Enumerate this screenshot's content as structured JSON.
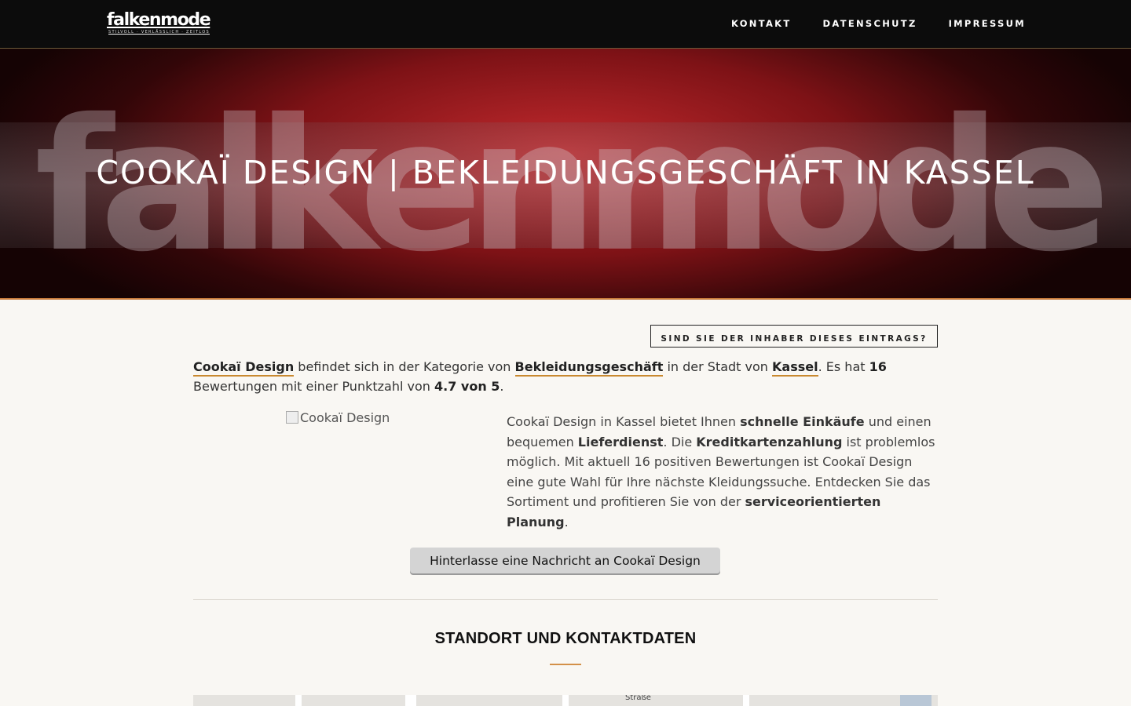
{
  "header": {
    "logo_text": "falkenmode",
    "logo_tagline": "STILVOLL · VERLÄSSLICH · ZEITLOS",
    "nav": [
      {
        "label": "KONTAKT"
      },
      {
        "label": "DATENSCHUTZ"
      },
      {
        "label": "IMPRESSUM"
      }
    ]
  },
  "hero": {
    "watermark": "falkenmode",
    "title": "COOKAÏ DESIGN | BEKLEIDUNGSGESCHÄFT IN KASSEL"
  },
  "owner_button": "SIND SIE DER INHABER DIESES EINTRAGS?",
  "intro": {
    "business_link": "Cookaï Design",
    "t1": " befindet sich in der Kategorie von ",
    "category_link": "Bekleidungsgeschäft",
    "t2": " in der Stadt von ",
    "city_link": "Kassel",
    "t3": ". Es hat ",
    "review_count": "16",
    "t4": " Bewertungen mit einer Punktzahl von ",
    "score": "4.7 von 5",
    "t5": "."
  },
  "image_alt": "Cookaï Design",
  "description": {
    "p1": "Cookaï Design in Kassel bietet Ihnen ",
    "b1": "schnelle Einkäufe",
    "p2": " und einen bequemen ",
    "b2": "Lieferdienst",
    "p3": ". Die ",
    "b3": "Kreditkartenzahlung",
    "p4": " ist problemlos möglich. Mit aktuell 16 positiven Bewertungen ist Cookaï Design eine gute Wahl für Ihre nächste Kleidungssuche. Entdecken Sie das Sortiment und profitieren Sie von der ",
    "b4": "serviceorientierten Planung",
    "p5": "."
  },
  "message_button": "Hinterlasse eine Nachricht an Cookaï Design",
  "section_title": "STANDORT UND KONTAKTDATEN",
  "map": {
    "label": "Straße"
  },
  "colors": {
    "header_bg": "#0c0c0c",
    "accent": "#c9892f",
    "hero_red": "#c32a2e",
    "page_bg": "#f9f7f3"
  }
}
